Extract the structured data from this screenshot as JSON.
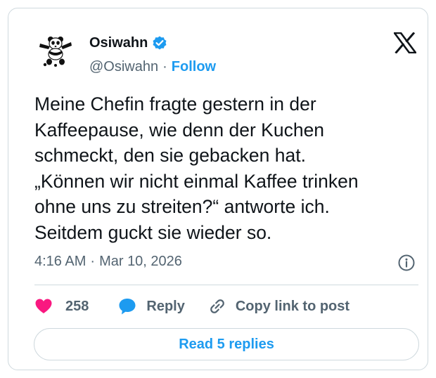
{
  "author": {
    "display_name": "Osiwahn",
    "handle": "@Osiwahn",
    "verified": true,
    "follow_label": "Follow"
  },
  "tweet": {
    "lines": [
      "Meine Chefin fragte gestern in der",
      "Kaffeepause, wie denn der Kuchen",
      "schmeckt, den sie gebacken hat.",
      "„Können wir nicht einmal Kaffee trinken",
      "ohne uns zu streiten?“ antworte ich.",
      "Seitdem guckt sie wieder so."
    ],
    "time": "4:16 AM",
    "separator": "·",
    "date": "Mar 10, 2026"
  },
  "actions": {
    "like_count": "258",
    "reply_label": "Reply",
    "copy_label": "Copy link to post"
  },
  "footer": {
    "read_replies_label": "Read 5 replies"
  },
  "icons": {
    "brand": "x-logo-icon",
    "verified": "verified-badge-icon",
    "info": "info-icon",
    "like": "heart-icon",
    "reply": "speech-bubble-icon",
    "copy": "link-icon"
  },
  "colors": {
    "accent": "#1d9bf0",
    "like": "#f91880",
    "text": "#0f1419",
    "muted": "#536471",
    "border": "#cfd9de"
  }
}
